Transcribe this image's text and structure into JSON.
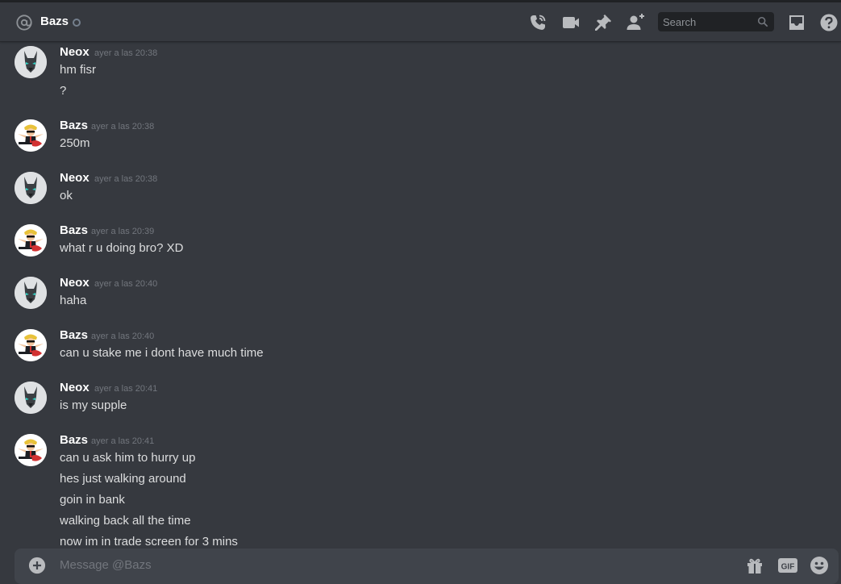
{
  "header": {
    "channel_name": "Bazs",
    "search_placeholder": "Search",
    "icons": [
      "at-icon",
      "status-icon",
      "call-icon",
      "video-icon",
      "pin-icon",
      "add-friend-icon",
      "search-icon",
      "inbox-icon",
      "help-icon"
    ]
  },
  "messages": [
    {
      "author": "Neox",
      "avatar": "wolf",
      "time": "ayer a las 20:38",
      "lines": [
        "hm fisr",
        "?"
      ]
    },
    {
      "author": "Bazs",
      "avatar": "wallstreet",
      "time": "ayer a las 20:38",
      "lines": [
        "250m"
      ]
    },
    {
      "author": "Neox",
      "avatar": "wolf",
      "time": "ayer a las 20:38",
      "lines": [
        "ok"
      ]
    },
    {
      "author": "Bazs",
      "avatar": "wallstreet",
      "time": "ayer a las 20:39",
      "lines": [
        "what r u doing bro? XD"
      ]
    },
    {
      "author": "Neox",
      "avatar": "wolf",
      "time": "ayer a las 20:40",
      "lines": [
        "haha"
      ]
    },
    {
      "author": "Bazs",
      "avatar": "wallstreet",
      "time": "ayer a las 20:40",
      "lines": [
        "can u stake me i dont have much time"
      ]
    },
    {
      "author": "Neox",
      "avatar": "wolf",
      "time": "ayer a las 20:41",
      "lines": [
        "is my supple"
      ]
    },
    {
      "author": "Bazs",
      "avatar": "wallstreet",
      "time": "ayer a las 20:41",
      "lines": [
        "can u ask him to hurry up",
        "hes just walking around",
        "goin in bank",
        "walking back all the time",
        "now im in trade screen for 3 mins"
      ]
    }
  ],
  "composer": {
    "placeholder": "Message @Bazs",
    "gif_label": "GIF",
    "icons": [
      "add-attachment-icon",
      "gift-icon",
      "gif-icon",
      "emoji-icon"
    ]
  }
}
